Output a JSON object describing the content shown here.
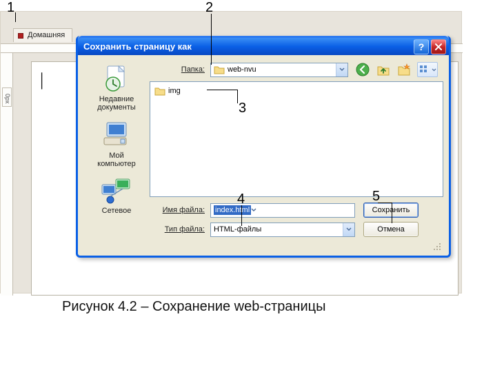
{
  "background": {
    "tab_label": "Домашняя",
    "vruler_cell": "0px"
  },
  "dialog": {
    "title": "Сохранить страницу как",
    "folder_label": "Папка:",
    "folder_value": "web-nvu",
    "filelist": {
      "items": [
        {
          "name": "img",
          "type": "folder"
        }
      ]
    },
    "filename_label": "Имя файла:",
    "filename_value": "index.html",
    "filetype_label": "Тип файла:",
    "filetype_value": "HTML-файлы",
    "save_button": "Сохранить",
    "cancel_button": "Отмена",
    "help_symbol": "?",
    "places": [
      {
        "label": "Недавние\nдокументы",
        "icon": "recent-docs-icon"
      },
      {
        "label": "Мой\nкомпьютер",
        "icon": "my-computer-icon"
      },
      {
        "label": "Сетевое",
        "icon": "network-places-icon"
      }
    ],
    "toolbar": {
      "back": "back-icon",
      "up": "up-one-level-icon",
      "newfolder": "new-folder-icon",
      "views": "views-menu-icon"
    }
  },
  "callouts": {
    "n1": "1",
    "n2": "2",
    "n3": "3",
    "n4": "4",
    "n5": "5"
  },
  "caption": "Рисунок 4.2 – Сохранение web-страницы"
}
